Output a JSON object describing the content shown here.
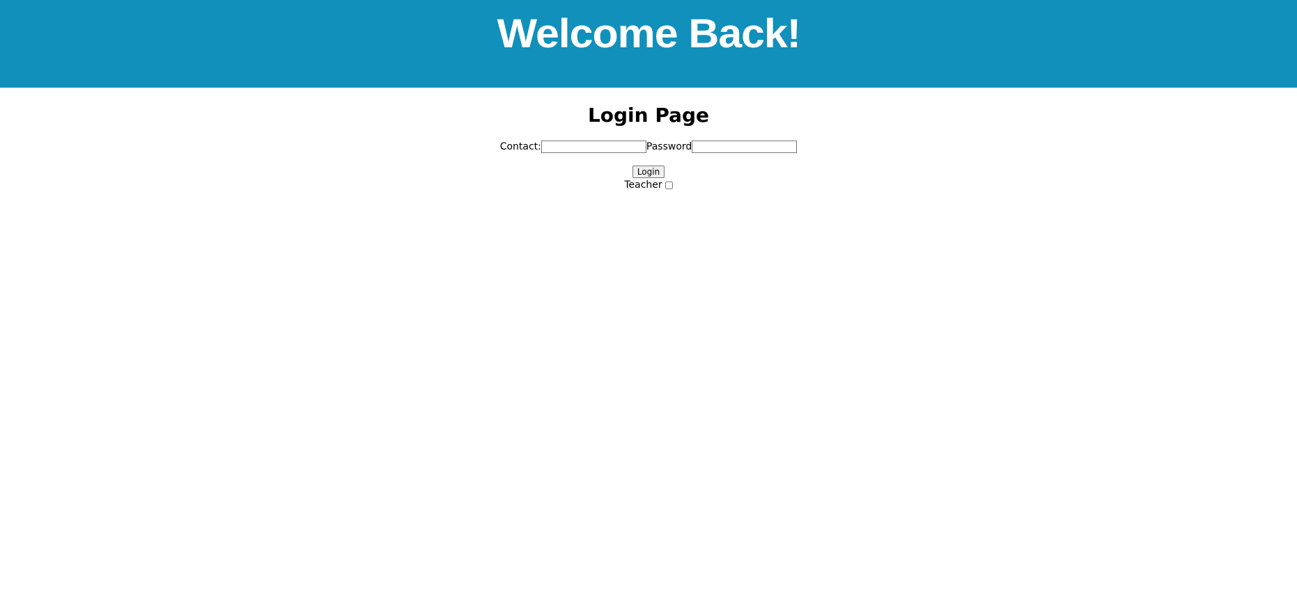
{
  "banner": {
    "title": "Welcome Back!",
    "background_color": "#1090bb"
  },
  "login": {
    "heading": "Login Page",
    "contact_label": "Contact:",
    "contact_value": "",
    "password_label": "Password",
    "password_value": "",
    "button_label": "Login",
    "teacher_label": "Teacher",
    "teacher_checked": false
  }
}
